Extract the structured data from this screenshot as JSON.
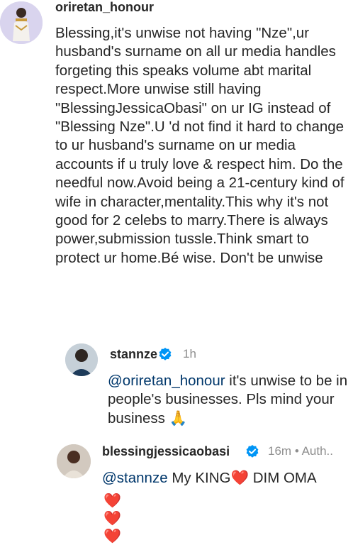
{
  "colors": {
    "text": "#262626",
    "muted": "#8e8e8e",
    "mention": "#00376b",
    "verified": "#0095f6",
    "heart": "#ed4956"
  },
  "comments": [
    {
      "username": "oriretan_honour",
      "avatar": "man-in-white-outfit-avatar",
      "text": "Blessing,it's unwise not having \"Nze\",ur husband's surname on all ur media handles forgeting this speaks volume abt marital respect.More unwise still having \"BlessingJessicaObasi\" on ur IG instead of \"Blessing Nze\".U 'd not find it hard to change to ur husband's surname on ur media accounts if u truly love & respect him. Do the needful now.Avoid being a 21-century kind of wife in character,mentality.This why it's not good for 2 celebs to marry.There is always power,submission tussle.Think smart to protect ur home.Bé wise. Don't be unwise"
    },
    {
      "username": "stannze",
      "verified": true,
      "time": "1h",
      "avatar": "man-portrait-avatar",
      "mention": "@oriretan_honour",
      "text": " it's unwise to be in people's businesses. Pls mind your business",
      "emoji": "🙏"
    },
    {
      "username": "blessingjessicaobasi",
      "verified": true,
      "time": "16m",
      "separator": "•",
      "tag": "Auth..",
      "avatar": "woman-portrait-avatar",
      "mention": "@stannze",
      "text_part1": " My KING",
      "heart": "❤️",
      "text_part2": " DIM OMA",
      "hearts": "❤️❤️❤️"
    }
  ]
}
